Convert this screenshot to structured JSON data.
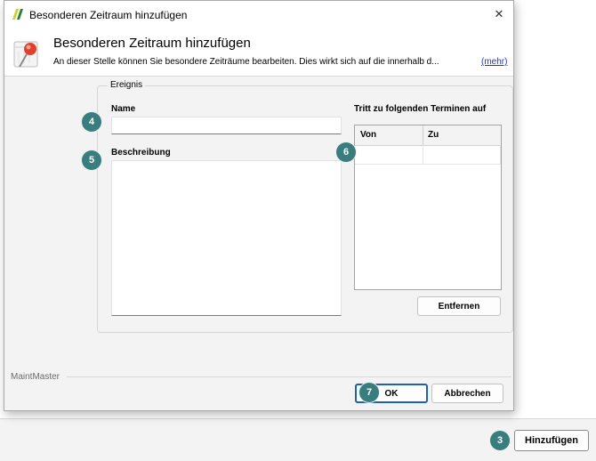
{
  "window": {
    "title": "Besonderen Zeitraum hinzufügen",
    "close_glyph": "✕"
  },
  "header": {
    "title": "Besonderen Zeitraum hinzufügen",
    "description": "An dieser Stelle können Sie besondere Zeiträume bearbeiten. Dies wirkt sich auf die innerhalb d...",
    "more_link": "(mehr)"
  },
  "group": {
    "legend": "Ereignis",
    "name_label": "Name",
    "name_value": "",
    "description_label": "Beschreibung",
    "description_value": "",
    "dates_label": "Tritt zu folgenden Terminen auf",
    "columns": [
      "Von",
      "Zu"
    ],
    "remove_button": "Entfernen"
  },
  "footer": {
    "brand": "MaintMaster",
    "ok_button": "OK",
    "cancel_button": "Abbrechen"
  },
  "background": {
    "add_button": "Hinzufügen"
  },
  "annotations": {
    "badge_3": "3",
    "badge_4": "4",
    "badge_5": "5",
    "badge_6": "6",
    "badge_7": "7"
  },
  "colors": {
    "badge": "#3a7d7e",
    "link": "#1f3bb7",
    "dialog_bg": "#f3f3f3"
  },
  "icons": {
    "app": "maintmaster-logo-icon",
    "header": "calendar-pin-icon",
    "close": "close-icon"
  }
}
